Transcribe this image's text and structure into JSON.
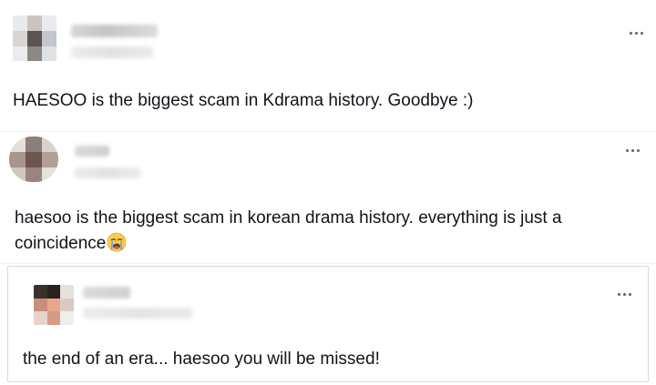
{
  "posts": [
    {
      "text": "HAESOO is the biggest scam in Kdrama history. Goodbye :)"
    },
    {
      "text_line1": "haesoo is the biggest scam in korean drama history. everything is just a",
      "text_line2": "coincidence",
      "emoji": "loudly-crying-face-emoji"
    },
    {
      "text": "the end of an era... haesoo you will be missed!"
    }
  ],
  "icons": {
    "more": "more-horizontal-icon",
    "avatar": "pixelated-avatar"
  },
  "colors": {
    "text": "#0f1419",
    "icon": "#536471",
    "divider": "#eff3f4",
    "quote_border": "#cfd9de"
  }
}
